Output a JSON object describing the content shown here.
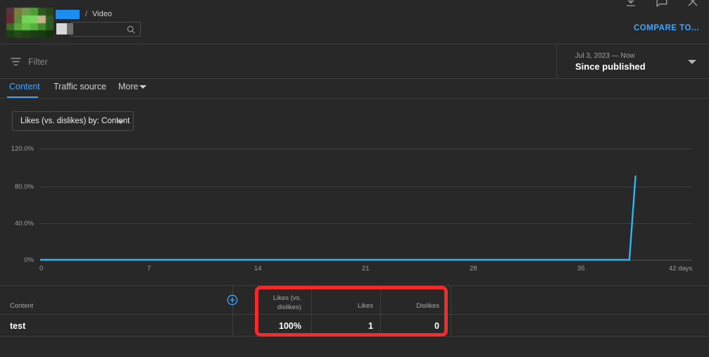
{
  "header": {
    "breadcrumb_separator": "/",
    "breadcrumb_current": "Video",
    "channel_redacted": true,
    "search_placeholder": "",
    "search_value": "",
    "search_icon": "search-icon",
    "download_icon": "download-icon",
    "comment_icon": "comment-icon",
    "close_icon": "close-icon",
    "compare_to_label": "COMPARE TO..."
  },
  "filterbar": {
    "filter_icon": "filter-icon",
    "filter_label": "Filter",
    "date_range_sub": "Jul 3, 2023 — Now",
    "date_range_main": "Since published",
    "date_caret_icon": "chevron-down-icon"
  },
  "tabs": [
    {
      "label": "Content",
      "active": true
    },
    {
      "label": "Traffic source",
      "active": false
    },
    {
      "label": "More",
      "active": false
    }
  ],
  "metric_selector": {
    "label": "Likes (vs. dislikes) by: Content",
    "caret_icon": "chevron-down-icon"
  },
  "chart_data": {
    "type": "line",
    "title": "Likes (vs. dislikes) by: Content",
    "xlabel": "days",
    "ylabel": "",
    "x": [
      0,
      7,
      14,
      21,
      28,
      35,
      38,
      38.4,
      42
    ],
    "series": [
      {
        "name": "test",
        "color": "#29b6f6",
        "values": [
          0,
          0,
          0,
          0,
          0,
          0,
          0,
          100,
          null
        ]
      }
    ],
    "y_ticks": [
      "0%",
      "40.0%",
      "80.0%",
      "120.0%"
    ],
    "y_tick_values": [
      0,
      40,
      80,
      120
    ],
    "ylim": [
      0,
      132
    ],
    "x_ticks": [
      "0",
      "7",
      "14",
      "21",
      "28",
      "35",
      "42 days"
    ],
    "x_tick_values": [
      0,
      7,
      14,
      21,
      28,
      35,
      42
    ],
    "xlim": [
      0,
      42
    ],
    "grid": true,
    "legend": false
  },
  "table": {
    "add_column_icon": "add-column-icon",
    "columns": [
      {
        "label": "Content",
        "align": "left"
      },
      {
        "label": "Likes (vs. dislikes)",
        "align": "right"
      },
      {
        "label": "Likes",
        "align": "right"
      },
      {
        "label": "Dislikes",
        "align": "right"
      }
    ],
    "rows": [
      {
        "content": "test",
        "likes_vs_dislikes": "100%",
        "likes": "1",
        "dislikes": "0"
      }
    ],
    "highlight_color": "#f42b2b"
  }
}
